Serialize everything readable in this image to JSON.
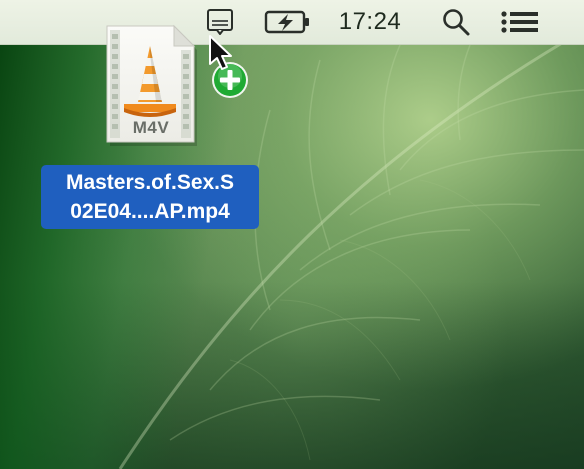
{
  "menubar": {
    "clock": "17:24",
    "icons": [
      "notification-icon",
      "battery-charging-icon",
      "spotlight-search-icon",
      "notification-center-icon"
    ]
  },
  "desktop_item": {
    "badge": "M4V",
    "label_line1": "Masters.of.Sex.S",
    "label_line2": "02E04....AP.mp4"
  },
  "colors": {
    "menubar_bg": "#e6ecdf",
    "selection": "#1f5fbf",
    "cone_orange": "#f08a1c",
    "add_badge": "#1faa33"
  }
}
